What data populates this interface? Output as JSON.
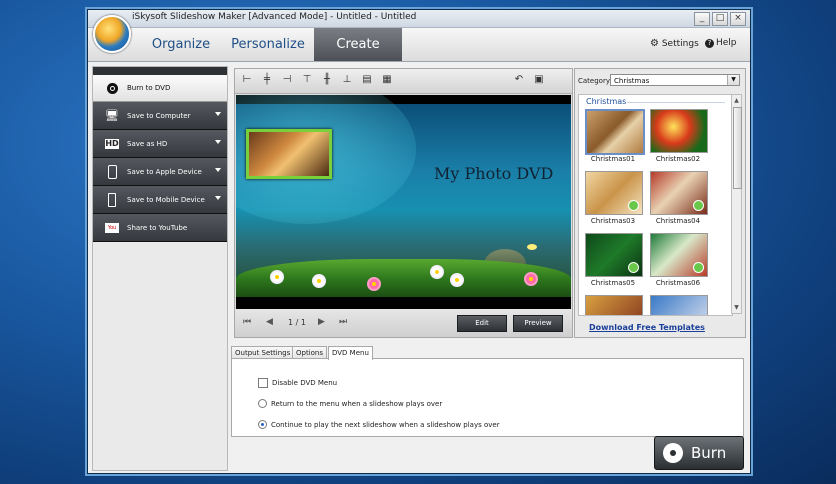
{
  "window": {
    "title": "iSkysoft Slideshow Maker [Advanced Mode] - Untitled - Untitled",
    "controls": [
      "_",
      "□",
      "×"
    ]
  },
  "menu": {
    "tabs": [
      "Organize",
      "Personalize",
      "Create"
    ],
    "active_tab": "Create",
    "settings_label": "Settings",
    "help_label": "Help"
  },
  "output_options": [
    {
      "label": "Burn to DVD",
      "icon": "dvd-disc-icon",
      "active": true
    },
    {
      "label": "Save to Computer",
      "icon": "computer-icon"
    },
    {
      "label": "Save as HD",
      "icon": "hd-icon"
    },
    {
      "label": "Save to Apple Device",
      "icon": "apple-device-icon"
    },
    {
      "label": "Save to Mobile Device",
      "icon": "mobile-device-icon"
    },
    {
      "label": "Share to YouTube",
      "icon": "youtube-icon"
    }
  ],
  "preview": {
    "dvd_title": "My Photo DVD",
    "page_info": "1 / 1",
    "edit_label": "Edit",
    "preview_label": "Preview"
  },
  "templates": {
    "category_label": "Category",
    "category_value": "Christmas",
    "section_heading": "Christmas",
    "items": [
      {
        "label": "Christmas01"
      },
      {
        "label": "Christmas02"
      },
      {
        "label": "Christmas03"
      },
      {
        "label": "Christmas04"
      },
      {
        "label": "Christmas05"
      },
      {
        "label": "Christmas06"
      }
    ],
    "download_link": "Download Free Templates"
  },
  "settings_tabs": {
    "tabs": [
      "Output Settings",
      "Options",
      "DVD Menu"
    ],
    "active_tab": "DVD Menu",
    "disable_menu_label": "Disable DVD Menu",
    "return_menu_label": "Return to the menu when a slideshow plays over",
    "continue_label": "Continue to play the next slideshow when a slideshow plays over",
    "selected_option": "continue"
  },
  "burn_label": "Burn"
}
